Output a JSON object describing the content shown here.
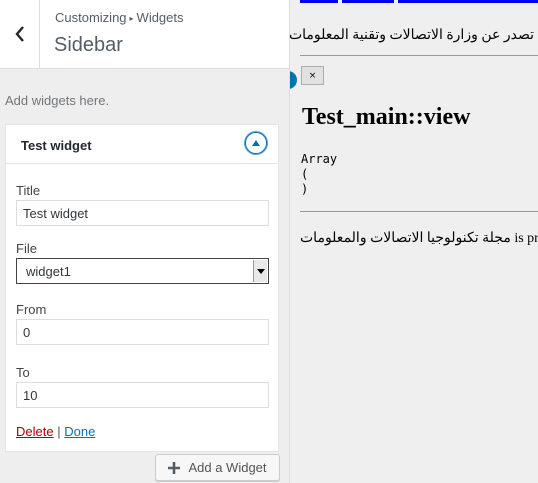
{
  "header": {
    "breadcrumb_parent": "Customizing",
    "breadcrumb_arrow": "▸",
    "breadcrumb_section": "Widgets",
    "title": "Sidebar"
  },
  "description": "Add widgets here.",
  "widget": {
    "title": "Test widget",
    "fields": {
      "title": {
        "label": "Title",
        "value": "Test widget"
      },
      "file": {
        "label": "File",
        "value": "widget1"
      },
      "from": {
        "label": "From",
        "value": "0"
      },
      "to": {
        "label": "To",
        "value": "10"
      }
    },
    "delete_label": "Delete",
    "separator": "|",
    "done_label": "Done"
  },
  "add_widget_label": "Add a Widget",
  "preview": {
    "line1": "تصدر عن وزارة الاتصالات وتقنية المعلومات",
    "close_button": "×",
    "heading": "Test_main::view",
    "array_dump": "Array\n(\n)",
    "line2": "مجلة تكنولوجيا الاتصالات والمعلومات is prov"
  },
  "colors": {
    "accent": "#0073aa",
    "delete": "#aa0000",
    "link": "#0000ee"
  }
}
